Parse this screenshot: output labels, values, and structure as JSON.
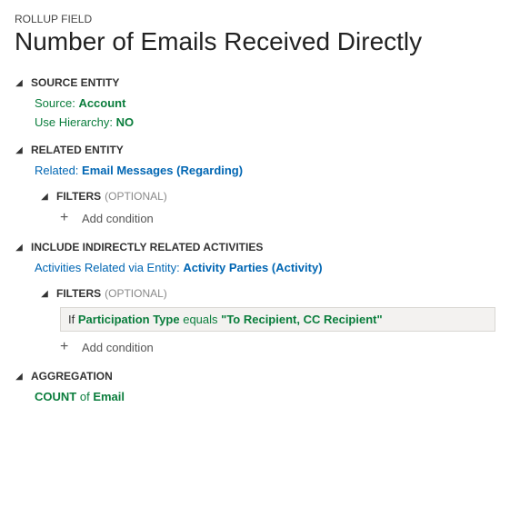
{
  "header": {
    "label": "ROLLUP FIELD",
    "title": "Number of Emails Received Directly"
  },
  "sourceEntity": {
    "title": "SOURCE ENTITY",
    "sourceLabel": "Source:",
    "sourceValue": "Account",
    "hierarchyLabel": "Use Hierarchy:",
    "hierarchyValue": "NO"
  },
  "relatedEntity": {
    "title": "RELATED ENTITY",
    "relatedLabel": "Related:",
    "relatedValue": "Email Messages",
    "relatedParen": "Regarding",
    "filters": {
      "title": "FILTERS",
      "optional": "(OPTIONAL)",
      "addCondition": "Add condition"
    }
  },
  "indirect": {
    "title": "INCLUDE INDIRECTLY RELATED ACTIVITIES",
    "relatedViaLabel": "Activities Related via Entity:",
    "relatedViaValue": "Activity Parties",
    "relatedViaParen": "Activity",
    "filters": {
      "title": "FILTERS",
      "optional": "(OPTIONAL)",
      "condition": {
        "if": "If",
        "field": "Participation Type",
        "op": "equals",
        "value": "\"To Recipient, CC Recipient\""
      },
      "addCondition": "Add condition"
    }
  },
  "aggregation": {
    "title": "AGGREGATION",
    "func": "COUNT",
    "of": "of",
    "field": "Email"
  }
}
